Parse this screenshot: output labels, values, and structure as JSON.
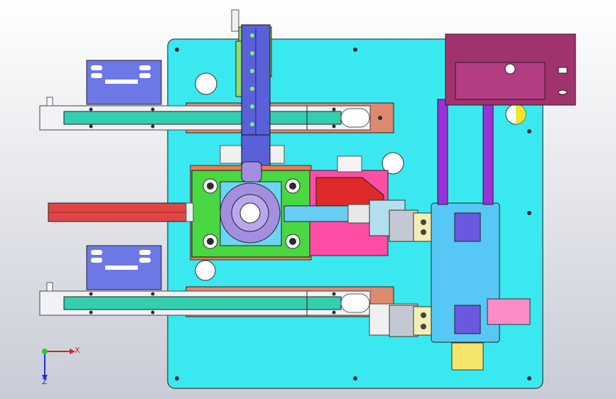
{
  "colors": {
    "background_top": "#ffffff",
    "background_bottom": "#c8ccd6",
    "base_plate": "#39e9ef",
    "conveyor_frame": "#f0f2f5",
    "conveyor_belt": "#33cfae",
    "conveyor_side_plate": "#de8a70",
    "bracket_blue": "#6c78e6",
    "slide_green": "#8ee06e",
    "slide_blue": "#5a60d8",
    "motor_mount_green": "#49d742",
    "motor_body": "#a58ee0",
    "rail_red": "#e04646",
    "pusher_pink": "#ff4da6",
    "gripper_yellow": "#f3eeb2",
    "module_blue": "#57c8f5",
    "panel_magenta": "#a0336e",
    "column_purple": "#9a32d9",
    "block_pink": "#fb8cc6",
    "bolt": "#2c2c3a"
  },
  "icons": {
    "triad": "coordinate-triad-icon"
  },
  "axes": {
    "x_label": "X",
    "y_label": "",
    "z_label": "Z"
  }
}
